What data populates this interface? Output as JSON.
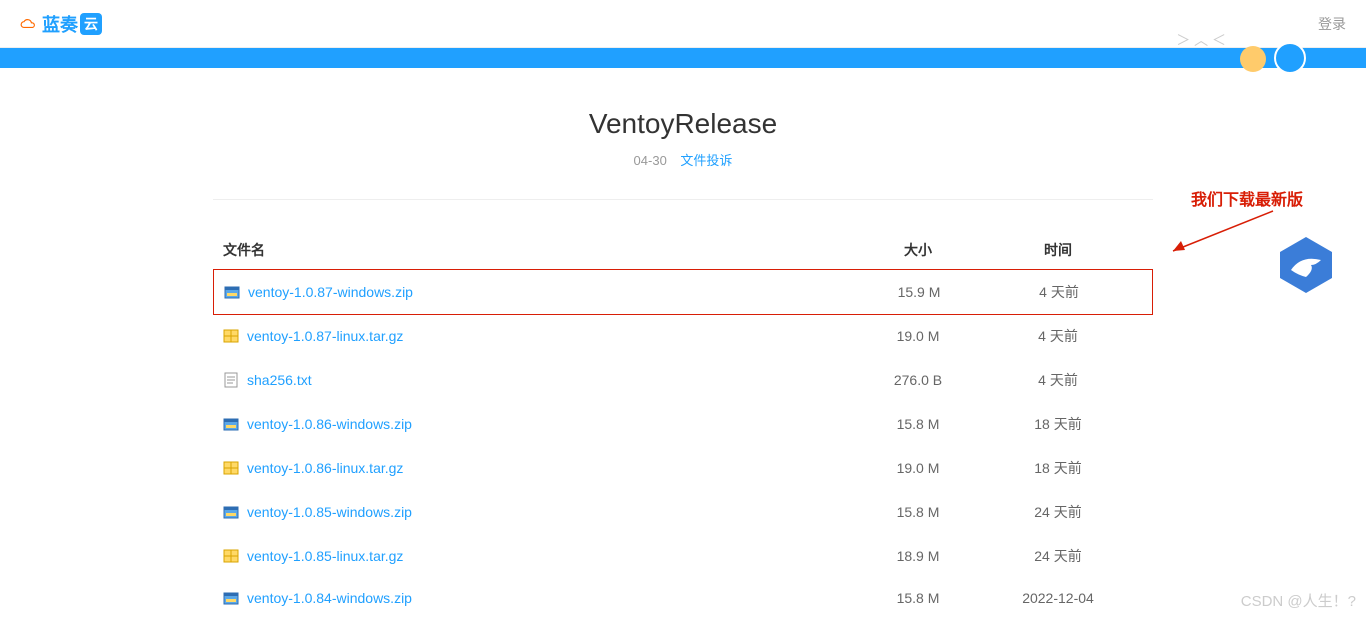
{
  "header": {
    "brand_text": "蓝奏",
    "brand_badge": "云",
    "login": "登录"
  },
  "page": {
    "title": "VentoyRelease",
    "date": "04-30",
    "complaint_link": "文件投诉"
  },
  "annotation": {
    "text": "我们下载最新版"
  },
  "columns": {
    "name": "文件名",
    "size": "大小",
    "time": "时间"
  },
  "files": [
    {
      "icon": "zip-win",
      "name": "ventoy-1.0.87-windows.zip",
      "size": "15.9 M",
      "time": "4 天前",
      "highlight": true
    },
    {
      "icon": "tar",
      "name": "ventoy-1.0.87-linux.tar.gz",
      "size": "19.0 M",
      "time": "4 天前"
    },
    {
      "icon": "txt",
      "name": "sha256.txt",
      "size": "276.0 B",
      "time": "4 天前"
    },
    {
      "icon": "zip-win",
      "name": "ventoy-1.0.86-windows.zip",
      "size": "15.8 M",
      "time": "18 天前"
    },
    {
      "icon": "tar",
      "name": "ventoy-1.0.86-linux.tar.gz",
      "size": "19.0 M",
      "time": "18 天前"
    },
    {
      "icon": "zip-win",
      "name": "ventoy-1.0.85-windows.zip",
      "size": "15.8 M",
      "time": "24 天前"
    },
    {
      "icon": "tar",
      "name": "ventoy-1.0.85-linux.tar.gz",
      "size": "18.9 M",
      "time": "24 天前"
    },
    {
      "icon": "zip-win",
      "name": "ventoy-1.0.84-windows.zip",
      "size": "15.8 M",
      "time": "2022-12-04"
    }
  ],
  "watermark": "CSDN @人生！?"
}
